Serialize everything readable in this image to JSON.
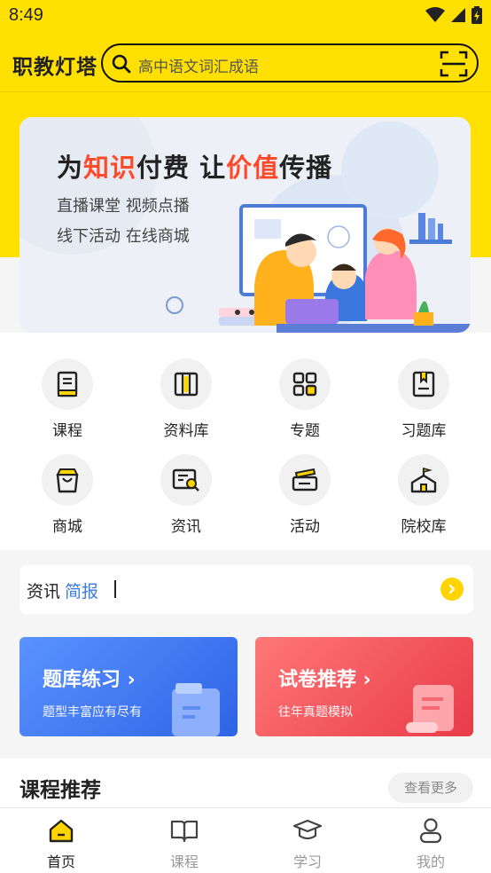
{
  "status": {
    "time": "8:49"
  },
  "header": {
    "brand": "职教灯塔",
    "search_placeholder": "高中语文词汇成语"
  },
  "banner": {
    "title_parts": [
      "为",
      "知识",
      "付费  让",
      "价值",
      "传播"
    ],
    "line1": "直播课堂  视频点播",
    "line2": "线下活动  在线商城"
  },
  "grid": [
    {
      "label": "课程",
      "icon": "book-icon"
    },
    {
      "label": "资料库",
      "icon": "library-icon"
    },
    {
      "label": "专题",
      "icon": "grid-squares-icon"
    },
    {
      "label": "习题库",
      "icon": "exercise-book-icon"
    },
    {
      "label": "商城",
      "icon": "shopping-bag-icon"
    },
    {
      "label": "资讯",
      "icon": "news-icon"
    },
    {
      "label": "活动",
      "icon": "ticket-icon"
    },
    {
      "label": "院校库",
      "icon": "school-icon"
    }
  ],
  "news": {
    "prefix": "资讯",
    "highlight": "简报"
  },
  "cards": [
    {
      "title": "题库练习 ›",
      "subtitle": "题型丰富应有尽有",
      "color": "#3b70f0"
    },
    {
      "title": "试卷推荐 ›",
      "subtitle": "往年真题模拟",
      "color": "#ef4b55"
    }
  ],
  "courses": {
    "title": "课程推荐",
    "more": "查看更多"
  },
  "tabs": [
    {
      "label": "首页",
      "icon": "home-icon",
      "active": true
    },
    {
      "label": "课程",
      "icon": "open-book-icon",
      "active": false
    },
    {
      "label": "学习",
      "icon": "graduation-cap-icon",
      "active": false
    },
    {
      "label": "我的",
      "icon": "user-icon",
      "active": false
    }
  ],
  "colors": {
    "brand_yellow": "#ffe000",
    "accent_blue": "#3b7be0",
    "accent_red": "#ff4a2a"
  }
}
